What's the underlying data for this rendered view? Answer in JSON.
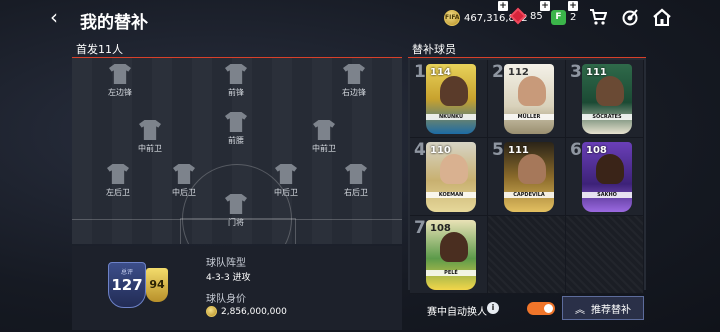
{
  "header": {
    "title": "我的替补",
    "coins": "467,316,892",
    "gems": "85",
    "fifa_points": "2"
  },
  "lineup": {
    "section_title": "首发11人",
    "positions": {
      "lw": "左边锋",
      "st": "前锋",
      "rw": "右边锋",
      "lcm": "中前卫",
      "cdm": "前腰",
      "rcm": "中前卫",
      "lb": "左后卫",
      "lcb": "中后卫",
      "rcb": "中后卫",
      "rb": "右后卫",
      "gk": "门将"
    }
  },
  "team": {
    "rating_label": "总评",
    "rating": "127",
    "chem": "94",
    "formation_label": "球队阵型",
    "formation": "4-3-3 进攻",
    "value_label": "球队身价",
    "value": "2,856,000,000"
  },
  "subs": {
    "section_title": "替补球员",
    "players": [
      {
        "num": "1",
        "ovr": "114",
        "name": "NKUNKU"
      },
      {
        "num": "2",
        "ovr": "112",
        "name": "MÜLLER"
      },
      {
        "num": "3",
        "ovr": "111",
        "name": "SÓCRATES"
      },
      {
        "num": "4",
        "ovr": "110",
        "name": "KOEMAN"
      },
      {
        "num": "5",
        "ovr": "111",
        "name": "CAPDEVILA"
      },
      {
        "num": "6",
        "ovr": "108",
        "name": "SAKHO"
      },
      {
        "num": "7",
        "ovr": "108",
        "name": "PELÉ"
      }
    ]
  },
  "footer": {
    "auto_sub_label": "赛中自动换人",
    "recommend_label": "推荐替补"
  },
  "colors": {
    "accent": "#f0752a",
    "header_line": "#d8402a"
  }
}
